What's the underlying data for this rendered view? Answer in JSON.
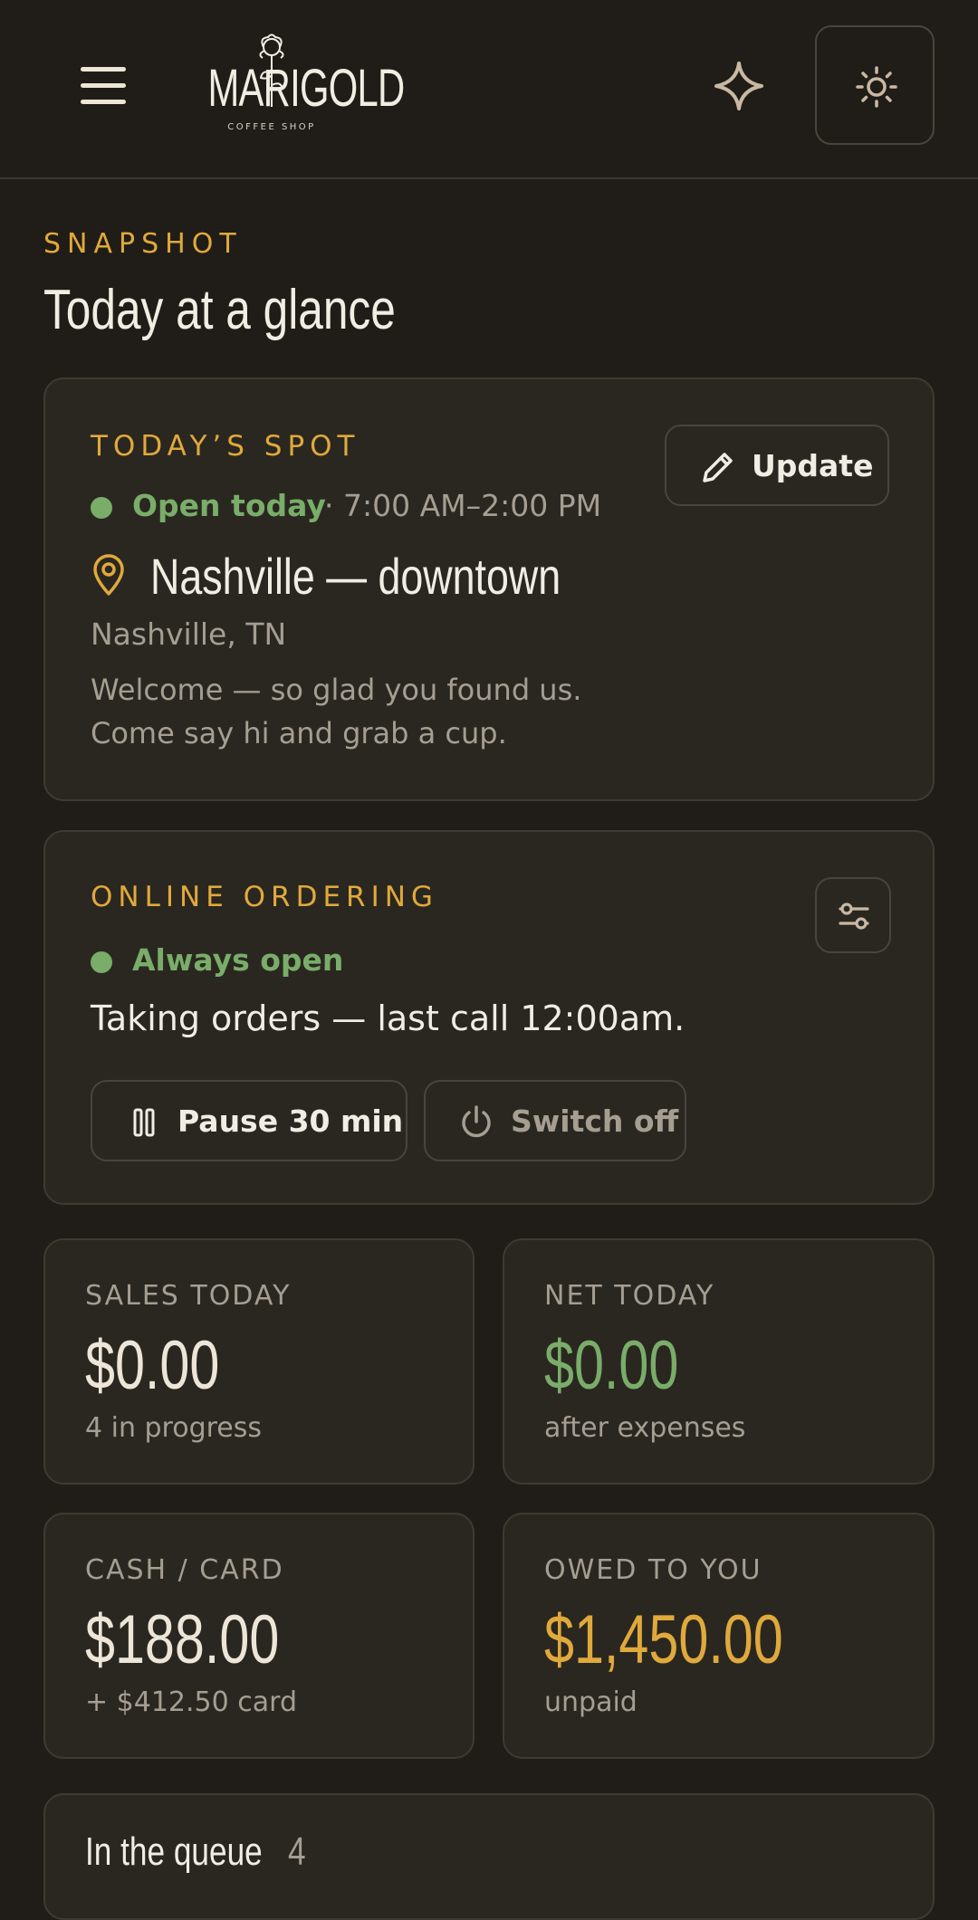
{
  "header": {
    "logo_text": "MARIGOLD",
    "logo_subtitle": "COFFEE SHOP",
    "menu_icon": "hamburger-menu-icon",
    "sparkle_icon": "sparkle-icon",
    "theme_icon": "sun-icon"
  },
  "snapshot": {
    "eyebrow": "SNAPSHOT",
    "title": "Today at a glance"
  },
  "todays_spot": {
    "label": "TODAY’S SPOT",
    "update_button": "Update",
    "status": "Open today",
    "hours": "· 7:00 AM–2:00 PM",
    "location_name": "Nashville — downtown",
    "city": "Nashville, TN",
    "message_line1": "Welcome — so glad you found us.",
    "message_line2": "Come say hi and grab a cup."
  },
  "online_ordering": {
    "label": "ONLINE ORDERING",
    "status": "Always open",
    "description": "Taking orders — last call 12:00am.",
    "pause_button": "Pause 30 min",
    "switch_off_button": "Switch off"
  },
  "stats": [
    {
      "label": "SALES TODAY",
      "value": "$0.00",
      "sub": "4 in progress",
      "color": "#ece5d8"
    },
    {
      "label": "NET TODAY",
      "value": "$0.00",
      "sub": "after expenses",
      "color": "#79ad69"
    },
    {
      "label": "CASH / CARD",
      "value": "$188.00",
      "sub": "+ $412.50 card",
      "color": "#ece5d8"
    },
    {
      "label": "OWED TO YOU",
      "value": "$1,450.00",
      "sub": "unpaid",
      "color": "#e0a93b"
    }
  ],
  "queue": {
    "title": "In the queue",
    "count": "4"
  },
  "colors": {
    "background": "#201d18",
    "card": "#2a2721",
    "accent": "#e0a93b",
    "success": "#79ad69",
    "text": "#ece5d8",
    "muted": "#a59e91"
  }
}
